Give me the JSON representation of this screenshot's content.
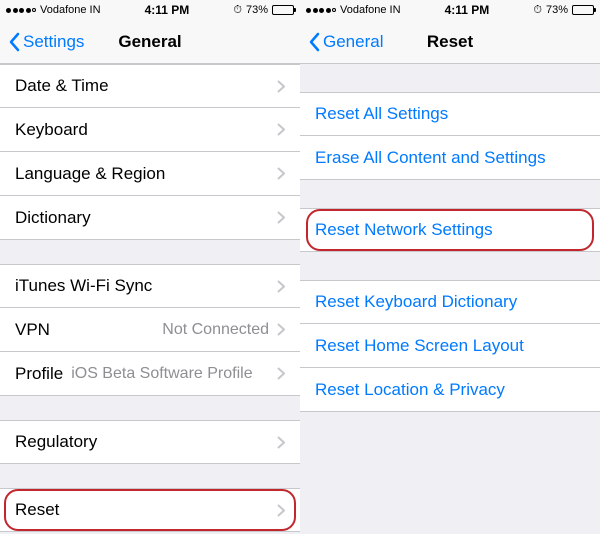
{
  "status": {
    "carrier": "Vodafone IN",
    "time": "4:11 PM",
    "battery_pct": "73%"
  },
  "left": {
    "back": "Settings",
    "title": "General",
    "group1": [
      {
        "label": "Date & Time"
      },
      {
        "label": "Keyboard"
      },
      {
        "label": "Language & Region"
      },
      {
        "label": "Dictionary"
      }
    ],
    "group2": [
      {
        "label": "iTunes Wi-Fi Sync"
      },
      {
        "label": "VPN",
        "detail": "Not Connected"
      },
      {
        "label": "Profile",
        "detail": "iOS Beta Software Profile"
      }
    ],
    "group3": [
      {
        "label": "Regulatory"
      }
    ],
    "group4": [
      {
        "label": "Reset"
      }
    ]
  },
  "right": {
    "back": "General",
    "title": "Reset",
    "group1": [
      {
        "label": "Reset All Settings"
      },
      {
        "label": "Erase All Content and Settings"
      }
    ],
    "group2": [
      {
        "label": "Reset Network Settings"
      }
    ],
    "group3": [
      {
        "label": "Reset Keyboard Dictionary"
      },
      {
        "label": "Reset Home Screen Layout"
      },
      {
        "label": "Reset Location & Privacy"
      }
    ]
  }
}
